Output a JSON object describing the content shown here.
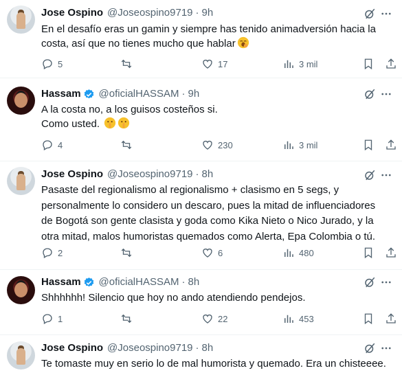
{
  "colors": {
    "text": "#0f1419",
    "muted": "#536471",
    "verified": "#1d9bf0",
    "divider": "#eff3f4"
  },
  "tweets": [
    {
      "name": "Jose Ospino",
      "handle": "@Joseospino9719",
      "time": "9h",
      "verified": false,
      "lines": [
        "En el desafío eras un gamin y siempre has tenido animadversión hacia la",
        "costa, así que no tienes mucho que hablar"
      ],
      "emoji": [
        "yawning-face"
      ],
      "replies": "5",
      "retweets": "",
      "likes": "17",
      "views": "3 mil"
    },
    {
      "name": "Hassam",
      "handle": "@oficialHASSAM",
      "time": "9h",
      "verified": true,
      "lines": [
        "A la costa no, a los guisos costeños si.",
        "Como usted."
      ],
      "emoji": [
        "shushing-face",
        "shushing-face"
      ],
      "replies": "4",
      "retweets": "",
      "likes": "230",
      "views": "3 mil"
    },
    {
      "name": "Jose Ospino",
      "handle": "@Joseospino9719",
      "time": "8h",
      "verified": false,
      "lines": [
        "Pasaste del regionalismo al regionalismo + clasismo en 5 segs, y",
        "personalmente lo considero un descaro, pues la mitad de influenciadores",
        "de Bogotá son gente clasista y goda como Kika Nieto o Nico Jurado, y la",
        "otra mitad, malos humoristas quemados como Alerta, Epa Colombia o tú."
      ],
      "emoji": [],
      "replies": "2",
      "retweets": "",
      "likes": "6",
      "views": "480"
    },
    {
      "name": "Hassam",
      "handle": "@oficialHASSAM",
      "time": "8h",
      "verified": true,
      "lines": [
        "Shhhhhh! Silencio que hoy no ando atendiendo pendejos."
      ],
      "emoji": [],
      "replies": "1",
      "retweets": "",
      "likes": "22",
      "views": "453"
    },
    {
      "name": "Jose Ospino",
      "handle": "@Joseospino9719",
      "time": "8h",
      "verified": false,
      "lines": [
        "Te tomaste muy en serio lo de mal humorista y quemado. Era un chisteeee."
      ],
      "emoji": [],
      "replies": "",
      "retweets": "",
      "likes": "",
      "views": ""
    }
  ],
  "separator": "·",
  "icons": [
    "grok-icon",
    "more-icon",
    "reply-icon",
    "retweet-icon",
    "like-icon",
    "views-icon",
    "bookmark-icon",
    "share-icon"
  ]
}
